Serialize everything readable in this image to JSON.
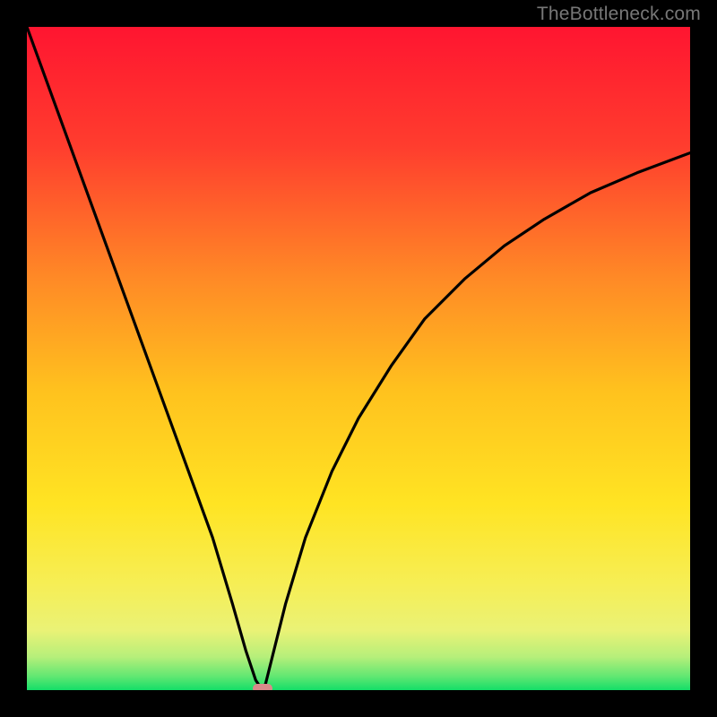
{
  "watermark": "TheBottleneck.com",
  "chart_data": {
    "type": "line",
    "title": "",
    "xlabel": "",
    "ylabel": "",
    "xlim": [
      0,
      100
    ],
    "ylim": [
      0,
      100
    ],
    "grid": false,
    "legend": false,
    "background_gradient": {
      "top": "#ff1a33",
      "upper_mid": "#ff7a2a",
      "mid": "#ffd21f",
      "lower_mid": "#f7ee5c",
      "bottom": "#17e06a"
    },
    "series": [
      {
        "name": "bottleneck-curve",
        "color": "#000000",
        "x": [
          0,
          4,
          8,
          12,
          16,
          20,
          24,
          28,
          31,
          33,
          34.5,
          35.5,
          36,
          37,
          39,
          42,
          46,
          50,
          55,
          60,
          66,
          72,
          78,
          85,
          92,
          100
        ],
        "values": [
          100,
          89,
          78,
          67,
          56,
          45,
          34,
          23,
          13,
          6,
          1.5,
          0,
          1,
          5,
          13,
          23,
          33,
          41,
          49,
          56,
          62,
          67,
          71,
          75,
          78,
          81
        ]
      }
    ],
    "marker": {
      "name": "optimal-point",
      "x": 35.5,
      "y": 0,
      "width_pct": 3.0,
      "height_pct": 1.4,
      "color": "#d98a8a"
    }
  }
}
